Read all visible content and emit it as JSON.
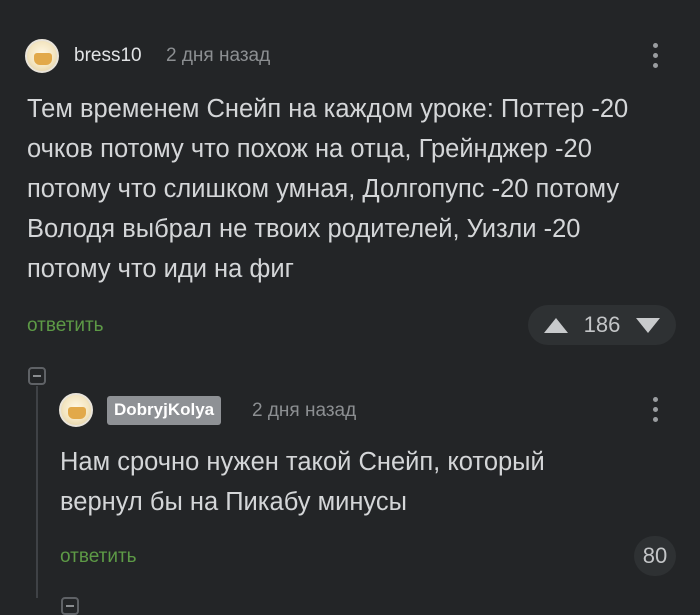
{
  "comments": [
    {
      "username": "bress10",
      "time": "2 дня назад",
      "text": "Тем временем Снейп на каждом уроке: Поттер -20\nочков потому что похож на отца, Грейнджер -20\nпотому что слишком умная, Долгопупс -20 потому\nВолодя выбрал не твоих родителей, Уизли -20\nпотому что иди на фиг",
      "reply_label": "ответить",
      "rating": "186"
    },
    {
      "username": "DobryjKolya",
      "time": "2 дня назад",
      "text": "Нам срочно нужен такой Снейп, который\nвернул бы на Пикабу минусы",
      "reply_label": "ответить",
      "rating": "80"
    }
  ],
  "colors": {
    "background": "#232527",
    "reply_link": "#5d9a46",
    "badge": "#8e9195"
  },
  "icons": [
    "avatar",
    "kebab-menu-icon",
    "upvote-icon",
    "downvote-icon",
    "collapse-thread-icon"
  ]
}
